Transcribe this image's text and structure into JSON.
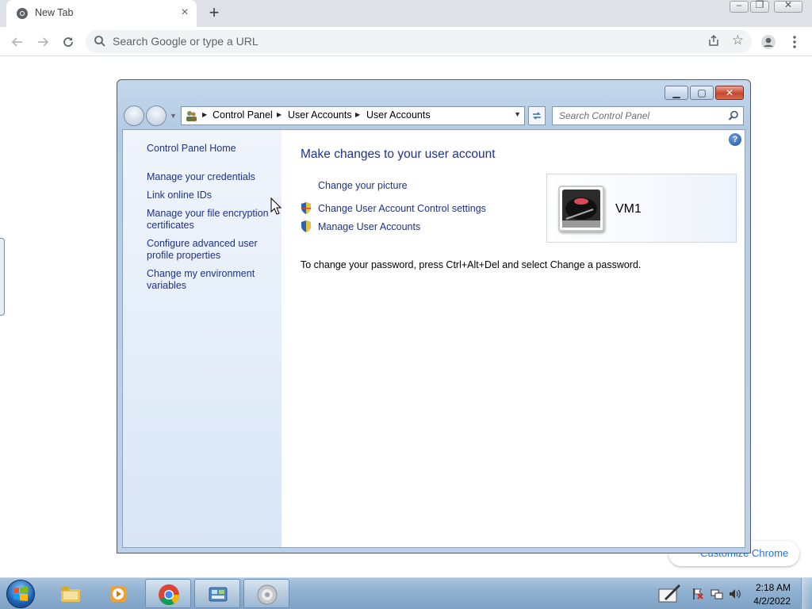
{
  "chrome": {
    "tab_title": "New Tab",
    "tab_close": "×",
    "new_tab": "+",
    "omnibox_placeholder": "Search Google or type a URL",
    "customize_label": "Customize Chrome"
  },
  "window": {
    "breadcrumbs": [
      "Control Panel",
      "User Accounts",
      "User Accounts"
    ],
    "search_placeholder": "Search Control Panel",
    "help": "?"
  },
  "sidebar": {
    "home": "Control Panel Home",
    "items": [
      "Manage your credentials",
      "Link online IDs",
      "Manage your file encryption certificates",
      "Configure advanced user profile properties",
      "Change my environment variables"
    ]
  },
  "main": {
    "title": "Make changes to your user account",
    "links": [
      "Change your picture",
      "Change User Account Control settings",
      "Manage User Accounts"
    ],
    "password_note": "To change your password, press Ctrl+Alt+Del and select Change a password.",
    "user_name": "VM1"
  },
  "taskbar": {
    "time": "2:18 AM",
    "date": "4/2/2022"
  },
  "colors": {
    "link": "#1e3287",
    "chrome_tabstrip": "#dee1e6",
    "taskbar": "#8fb0d0"
  }
}
